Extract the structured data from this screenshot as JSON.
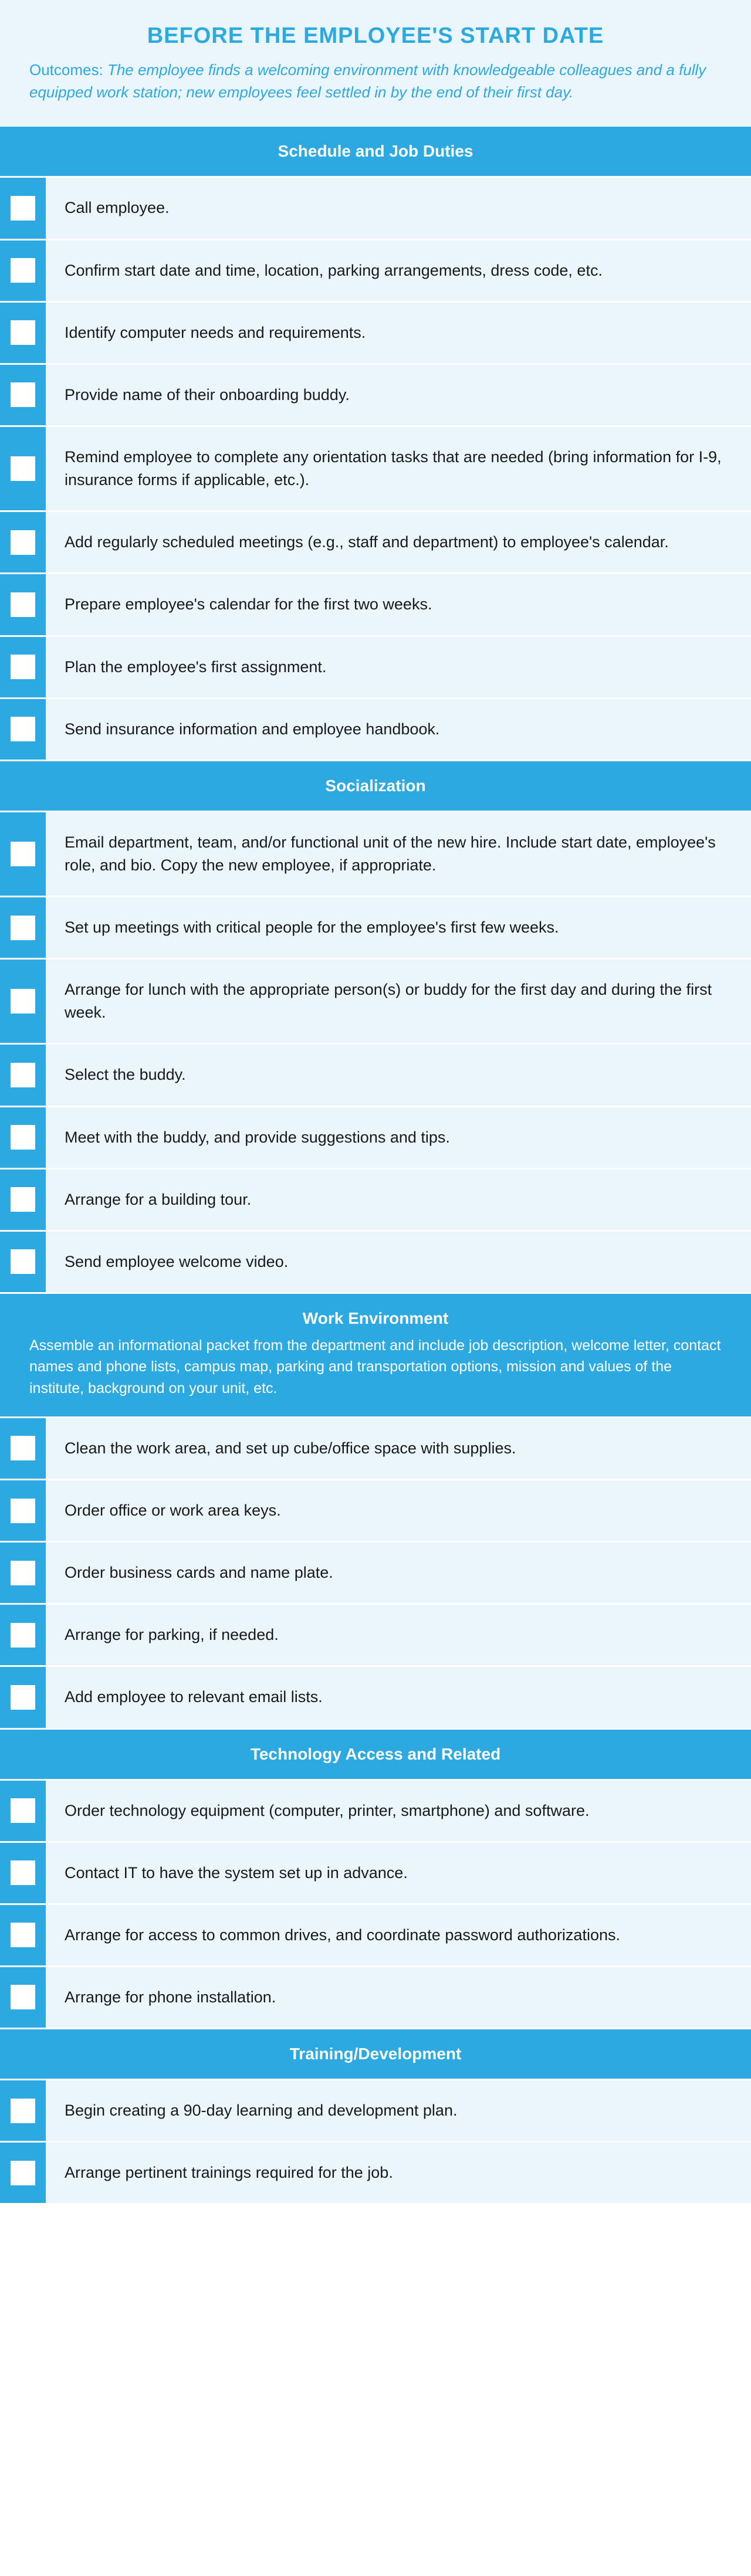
{
  "title": "BEFORE THE EMPLOYEE'S START DATE",
  "outcomes_label": "Outcomes: ",
  "outcomes_text": "The employee finds a welcoming environment with knowledgeable colleagues and a fully equipped work station; new employees feel settled in by the end of their first day.",
  "sections": [
    {
      "title": "Schedule and Job Duties",
      "desc": "",
      "items": [
        "Call employee.",
        "Confirm start date and time, location, parking arrangements, dress code, etc.",
        "Identify computer needs and requirements.",
        "Provide name of their onboarding buddy.",
        "Remind employee to complete any orientation tasks that are needed (bring information for I-9, insurance forms if applicable, etc.).",
        "Add regularly scheduled meetings (e.g., staff and department) to employee's calendar.",
        "Prepare employee's calendar for the first two weeks.",
        "Plan the employee's first assignment.",
        "Send insurance information and employee handbook."
      ]
    },
    {
      "title": "Socialization",
      "desc": "",
      "items": [
        "Email department, team, and/or functional unit of the new hire. Include start date, employee's role, and bio. Copy the new employee, if appropriate.",
        "Set up meetings with critical people for the employee's first few weeks.",
        "Arrange for lunch with the appropriate person(s) or buddy for the first day and during the first week.",
        "Select the buddy.",
        "Meet with the buddy, and provide suggestions and tips.",
        "Arrange for a building tour.",
        "Send employee welcome video."
      ]
    },
    {
      "title": "Work Environment",
      "desc": "Assemble an informational packet from the department and include job description, welcome letter, contact names and phone lists, campus map, parking and transportation options, mission and values of the institute, background on your unit, etc.",
      "items": [
        "Clean the work area, and set up cube/office space with supplies.",
        "Order office or work area keys.",
        "Order business cards and name plate.",
        "Arrange for parking, if needed.",
        "Add employee to relevant email lists."
      ]
    },
    {
      "title": "Technology Access and Related",
      "desc": "",
      "items": [
        "Order technology equipment (computer, printer, smartphone) and software.",
        "Contact IT to have the system set up in advance.",
        "Arrange for access to common drives, and coordinate password authorizations.",
        "Arrange for phone installation."
      ]
    },
    {
      "title": "Training/Development",
      "desc": "",
      "items": [
        "Begin creating a 90-day learning and development plan.",
        "Arrange pertinent trainings required for the job."
      ]
    }
  ]
}
